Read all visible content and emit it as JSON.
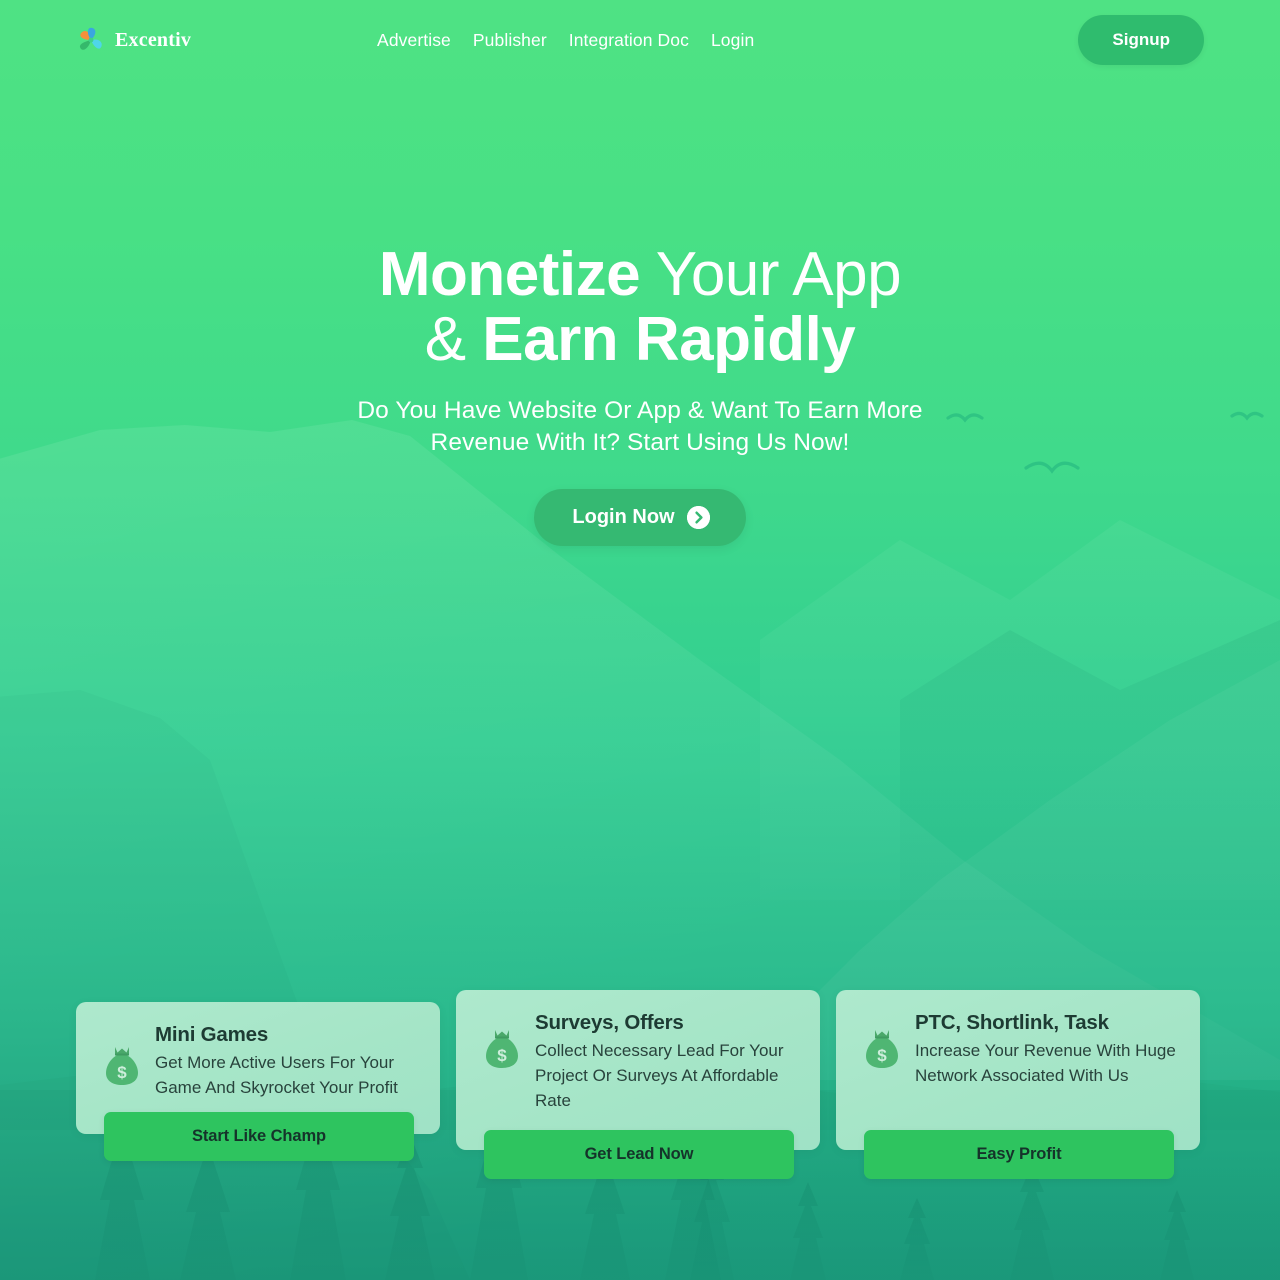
{
  "header": {
    "brand": {
      "name": "Excentiv",
      "icon": "pinwheel-logo-icon"
    },
    "nav": [
      {
        "label": "Advertise"
      },
      {
        "label": "Publisher"
      },
      {
        "label": "Integration Doc"
      },
      {
        "label": "Login"
      }
    ],
    "signup_label": "Signup"
  },
  "hero": {
    "title_bold_1": "Monetize",
    "title_light_1": " Your App",
    "title_light_2": "& ",
    "title_bold_2": "Earn Rapidly",
    "subtitle_line_1": "Do You Have Website Or App & Want To Earn More",
    "subtitle_line_2": "Revenue With It? Start Using Us Now!",
    "cta_label": "Login Now",
    "cta_icon": "arrow-right-circle-icon"
  },
  "cards": [
    {
      "icon": "money-bag-icon",
      "title": "Mini Games",
      "description": "Get More Active Users For Your Game And Skyrocket Your Profit",
      "button_label": "Start Like Champ"
    },
    {
      "icon": "money-bag-icon",
      "title": "Surveys, Offers",
      "description": "Collect Necessary Lead For Your Project Or Surveys At Affordable Rate",
      "button_label": "Get Lead Now"
    },
    {
      "icon": "money-bag-icon",
      "title": "PTC, Shortlink, Task",
      "description": "Increase Your Revenue With Huge Network Associated With Us",
      "button_label": "Easy Profit"
    }
  ],
  "colors": {
    "bg_top": "#4fe284",
    "bg_bottom": "#17997a",
    "signup_green": "#2fbc6e",
    "cta_green": "#35b972",
    "card_bg": "#a8e6c9",
    "card_button_green": "#2ec45f",
    "card_text_dark": "#1d3b33",
    "logo_orange": "#f6903a",
    "logo_blue": "#3aa6e0",
    "logo_cyan": "#4fd6e8",
    "logo_green": "#35b96b"
  }
}
